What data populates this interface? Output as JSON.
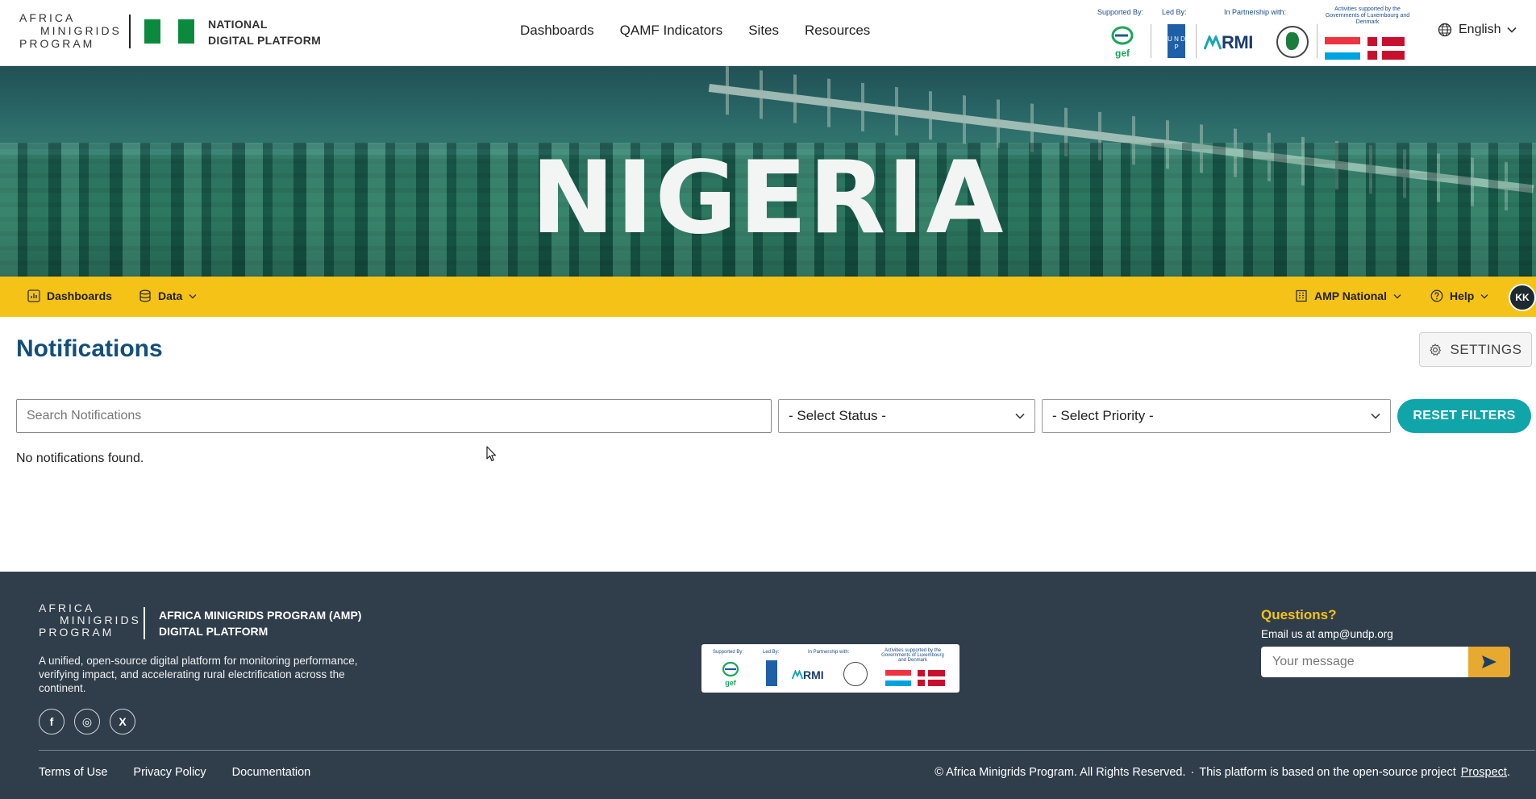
{
  "header": {
    "logo_line1": "AFRICA",
    "logo_line2": "MINIGRIDS",
    "logo_line3": "PROGRAM",
    "platform_line1": "NATIONAL",
    "platform_line2": "DIGITAL PLATFORM",
    "nav": [
      {
        "label": "Dashboards"
      },
      {
        "label": "QAMF Indicators"
      },
      {
        "label": "Sites"
      },
      {
        "label": "Resources"
      }
    ],
    "partners": {
      "supported_by": "Supported By:",
      "led_by": "Led By:",
      "in_partnership": "In Partnership with:",
      "activities": "Activities supported by the Governments of Luxembourg and Denmark",
      "gef": "gef",
      "undp": "U N D P",
      "rmi": "RMI"
    },
    "language": "English"
  },
  "hero": {
    "title": "NIGERIA"
  },
  "subnav": {
    "dashboards": "Dashboards",
    "data": "Data",
    "org": "AMP National",
    "help": "Help",
    "avatar_initials": "KK"
  },
  "notifications": {
    "title": "Notifications",
    "settings_label": "SETTINGS",
    "search_placeholder": "Search Notifications",
    "status_select": "- Select Status -",
    "priority_select": "- Select Priority -",
    "reset_label": "RESET FILTERS",
    "empty_message": "No notifications found."
  },
  "footer": {
    "logo_line1": "AFRICA",
    "logo_line2": "MINIGRIDS",
    "logo_line3": "PROGRAM",
    "title_line1": "AFRICA MINIGRIDS PROGRAM (AMP)",
    "title_line2": "DIGITAL PLATFORM",
    "description": "A unified, open-source digital platform for monitoring performance, verifying impact, and accelerating rural electrification across the continent.",
    "socials": [
      "f",
      "◎",
      "X"
    ],
    "questions_title": "Questions?",
    "email_text": "Email us at amp@undp.org",
    "message_placeholder": "Your message",
    "links": [
      {
        "label": "Terms of Use"
      },
      {
        "label": "Privacy Policy"
      },
      {
        "label": "Documentation"
      }
    ],
    "copyright": "© Africa Minigrids Program. All Rights Reserved.",
    "separator": "·",
    "based_on": "This platform is based on the open-source project",
    "prospect_link": "Prospect",
    "period": "."
  },
  "colors": {
    "accent_yellow": "#f5c217",
    "title_blue": "#134f7a",
    "teal_button": "#10a5a8",
    "footer_bg": "#303e4b",
    "send_button": "#e7a92f"
  }
}
